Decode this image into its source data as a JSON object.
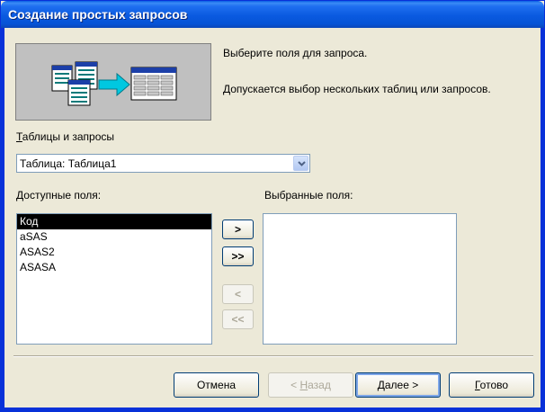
{
  "window": {
    "title": "Создание простых запросов"
  },
  "description": {
    "line1": "Выберите поля для запроса.",
    "line2": "Допускается выбор нескольких таблиц или запросов."
  },
  "tables": {
    "label_accel": "Т",
    "label_rest": "аблицы и запросы",
    "selected": "Таблица: Таблица1"
  },
  "available": {
    "label_accel": "Д",
    "label_rest": "оступные поля:",
    "items": [
      "Код",
      "aSAS",
      "ASAS2",
      "ASASA"
    ],
    "selected_index": 0
  },
  "selected_fields": {
    "label": "Выбранные поля:",
    "items": []
  },
  "move_buttons": {
    "add_one": ">",
    "add_all": ">>",
    "remove_one": "<",
    "remove_all": "<<"
  },
  "footer": {
    "cancel": "Отмена",
    "back_prefix": "< ",
    "back_accel": "Н",
    "back_rest": "азад",
    "next_accel": "Д",
    "next_rest": "алее >",
    "finish_accel": "Г",
    "finish_rest": "отово"
  },
  "colors": {
    "titlebar": "#0a5ae0",
    "face": "#ece9d8",
    "selection": "#000000"
  }
}
